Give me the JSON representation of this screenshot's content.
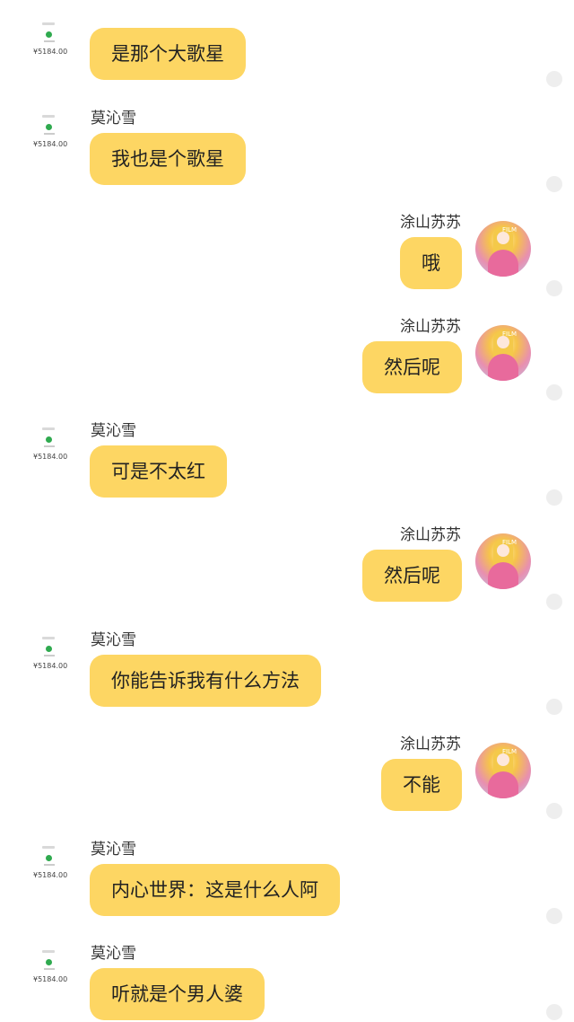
{
  "names": {
    "left_user": "莫沁雪",
    "right_user": "涂山苏苏"
  },
  "left_avatar": {
    "icon": "payment-receipt-avatar-icon",
    "price": "¥5184.00"
  },
  "right_avatar": {
    "icon": "anime-girl-avatar-icon",
    "tag": "FILM"
  },
  "colors": {
    "bubble": "#fdd663",
    "background": "#ffffff",
    "side_dot": "#eeeeee"
  },
  "messages": [
    {
      "side": "left",
      "show_name": false,
      "text": "是那个大歌星"
    },
    {
      "side": "left",
      "show_name": true,
      "name": "莫沁雪",
      "text": "我也是个歌星"
    },
    {
      "side": "right",
      "show_name": true,
      "name": "涂山苏苏",
      "text": "哦"
    },
    {
      "side": "right",
      "show_name": true,
      "name": "涂山苏苏",
      "text": "然后呢"
    },
    {
      "side": "left",
      "show_name": true,
      "name": "莫沁雪",
      "text": "可是不太红"
    },
    {
      "side": "right",
      "show_name": true,
      "name": "涂山苏苏",
      "text": "然后呢"
    },
    {
      "side": "left",
      "show_name": true,
      "name": "莫沁雪",
      "text": "你能告诉我有什么方法"
    },
    {
      "side": "right",
      "show_name": true,
      "name": "涂山苏苏",
      "text": "不能"
    },
    {
      "side": "left",
      "show_name": true,
      "name": "莫沁雪",
      "text": "内心世界：这是什么人阿"
    },
    {
      "side": "left",
      "show_name": true,
      "name": "莫沁雪",
      "text": "听就是个男人婆"
    }
  ]
}
